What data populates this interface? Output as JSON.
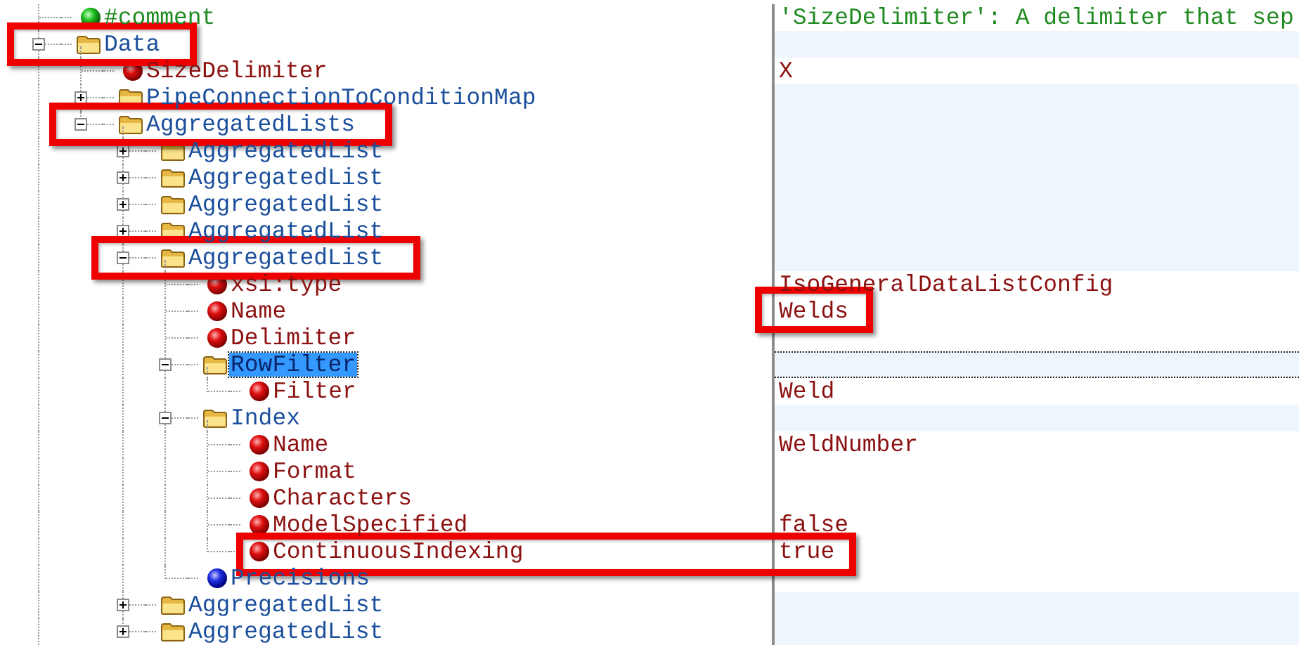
{
  "tree": [
    {
      "name": "#comment",
      "kind": "comment",
      "selected": false,
      "value": "'SizeDelimiter': A delimiter that sep"
    },
    {
      "name": "Data",
      "kind": "folder",
      "expanded": true,
      "selected": false,
      "framed": true,
      "children": [
        {
          "name": "SizeDelimiter",
          "kind": "attribute",
          "selected": false,
          "value": "X"
        },
        {
          "name": "PipeConnectionToConditionMap",
          "kind": "folder",
          "expanded": false,
          "selected": false
        },
        {
          "name": "AggregatedLists",
          "kind": "folder",
          "expanded": true,
          "selected": false,
          "framed": true,
          "children": [
            {
              "name": "AggregatedList",
              "kind": "folder",
              "expanded": false,
              "selected": false
            },
            {
              "name": "AggregatedList",
              "kind": "folder",
              "expanded": false,
              "selected": false
            },
            {
              "name": "AggregatedList",
              "kind": "folder",
              "expanded": false,
              "selected": false
            },
            {
              "name": "AggregatedList",
              "kind": "folder",
              "expanded": false,
              "selected": false
            },
            {
              "name": "AggregatedList",
              "kind": "folder",
              "expanded": true,
              "selected": false,
              "framed": true,
              "children": [
                {
                  "name": "xsi:type",
                  "kind": "attribute",
                  "selected": false,
                  "value": "IsoGeneralDataListConfig"
                },
                {
                  "name": "Name",
                  "kind": "attribute",
                  "selected": false,
                  "value": "Welds",
                  "value_framed": true
                },
                {
                  "name": "Delimiter",
                  "kind": "attribute",
                  "selected": false
                },
                {
                  "name": "RowFilter",
                  "kind": "folder",
                  "expanded": true,
                  "selected": true,
                  "children": [
                    {
                      "name": "Filter",
                      "kind": "attribute",
                      "selected": false,
                      "value": "Weld"
                    }
                  ]
                },
                {
                  "name": "Index",
                  "kind": "folder",
                  "expanded": true,
                  "selected": false,
                  "children": [
                    {
                      "name": "Name",
                      "kind": "attribute",
                      "selected": false,
                      "value": "WeldNumber"
                    },
                    {
                      "name": "Format",
                      "kind": "attribute",
                      "selected": false
                    },
                    {
                      "name": "Characters",
                      "kind": "attribute",
                      "selected": false
                    },
                    {
                      "name": "ModelSpecified",
                      "kind": "attribute",
                      "selected": false,
                      "value": "false"
                    },
                    {
                      "name": "ContinuousIndexing",
                      "kind": "attribute",
                      "selected": false,
                      "value": "true",
                      "row_framed": true
                    }
                  ]
                },
                {
                  "name": "Precisions",
                  "kind": "element",
                  "selected": false
                }
              ]
            },
            {
              "name": "AggregatedList",
              "kind": "folder",
              "expanded": false,
              "selected": false
            },
            {
              "name": "AggregatedList",
              "kind": "folder",
              "expanded": false,
              "selected": false
            }
          ]
        }
      ]
    }
  ]
}
